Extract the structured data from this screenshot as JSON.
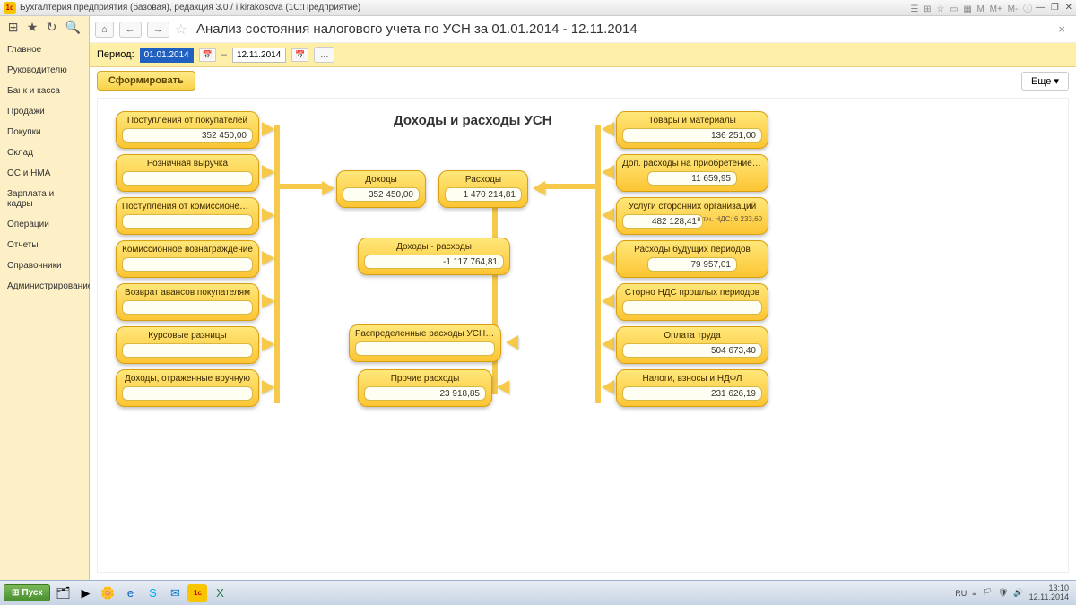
{
  "titlebar": {
    "app_title": "Бухгалтерия предприятия (базовая), редакция 3.0 / i.kirakosova  (1С:Предприятие)"
  },
  "sidebar": {
    "items": [
      {
        "label": "Главное"
      },
      {
        "label": "Руководителю"
      },
      {
        "label": "Банк и касса"
      },
      {
        "label": "Продажи"
      },
      {
        "label": "Покупки"
      },
      {
        "label": "Склад"
      },
      {
        "label": "ОС и НМА"
      },
      {
        "label": "Зарплата и кадры"
      },
      {
        "label": "Операции"
      },
      {
        "label": "Отчеты"
      },
      {
        "label": "Справочники"
      },
      {
        "label": "Администрирование"
      }
    ]
  },
  "header": {
    "page_title": "Анализ состояния налогового учета по УСН за 01.01.2014 - 12.11.2014"
  },
  "period": {
    "label": "Период:",
    "from": "01.01.2014",
    "to": "12.11.2014",
    "ellipsis": "..."
  },
  "actions": {
    "form_label": "Сформировать",
    "more_label": "Еще  ▾"
  },
  "diagram": {
    "title": "Доходы и расходы УСН",
    "left_col": [
      {
        "label": "Поступления от покупателей",
        "value": "352 450,00"
      },
      {
        "label": "Розничная выручка",
        "value": ""
      },
      {
        "label": "Поступления от комиссионеров",
        "value": ""
      },
      {
        "label": "Комиссионное вознаграждение",
        "value": ""
      },
      {
        "label": "Возврат авансов покупателям",
        "value": ""
      },
      {
        "label": "Курсовые разницы",
        "value": ""
      },
      {
        "label": "Доходы, отраженные вручную",
        "value": ""
      }
    ],
    "center": {
      "income": {
        "label": "Доходы",
        "value": "352 450,00"
      },
      "expense": {
        "label": "Расходы",
        "value": "1 470 214,81"
      },
      "diff": {
        "label": "Доходы - расходы",
        "value": "-1 117 764,81"
      },
      "distributed": {
        "label": "Распределенные расходы УСН / ЕНВД",
        "value": ""
      },
      "other": {
        "label": "Прочие расходы",
        "value": "23 918,85"
      }
    },
    "right_col": [
      {
        "label": "Товары и материалы",
        "value": "136 251,00"
      },
      {
        "label": "Доп. расходы на приобретение ТМЦ",
        "value": "11 659,95"
      },
      {
        "label": "Услуги сторонних организаций",
        "value": "482 128,41",
        "note": "в т.ч. НДС: 6 233,60"
      },
      {
        "label": "Расходы будущих периодов",
        "value": "79 957,01"
      },
      {
        "label": "Сторно НДС прошлых периодов",
        "value": ""
      },
      {
        "label": "Оплата труда",
        "value": "504 673,40"
      },
      {
        "label": "Налоги, взносы и НДФЛ",
        "value": "231 626,19"
      }
    ]
  },
  "taskbar": {
    "start": "Пуск",
    "lang": "RU",
    "time": "13:10",
    "date": "12.11.2014"
  }
}
